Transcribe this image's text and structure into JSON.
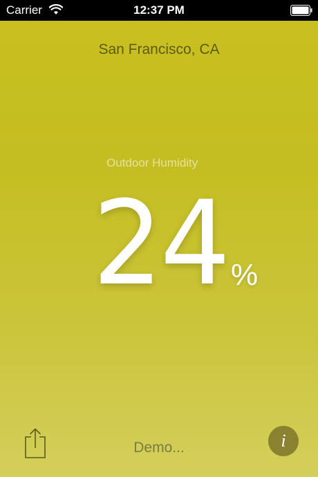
{
  "status_bar": {
    "carrier": "Carrier",
    "time": "12:37 PM",
    "wifi_icon": "wifi-icon",
    "battery_icon": "battery-icon"
  },
  "location": "San Francisco, CA",
  "metric": {
    "label": "Outdoor Humidity",
    "value": "24",
    "unit": "%"
  },
  "bottom_bar": {
    "share_icon": "share-icon",
    "demo_label": "Demo...",
    "info_glyph": "i",
    "info_icon": "info-icon"
  },
  "colors": {
    "background_top": "#c8c01f",
    "background_bottom": "#d3cf5b",
    "location_text": "#5e5a12",
    "info_button": "#8a8230"
  }
}
